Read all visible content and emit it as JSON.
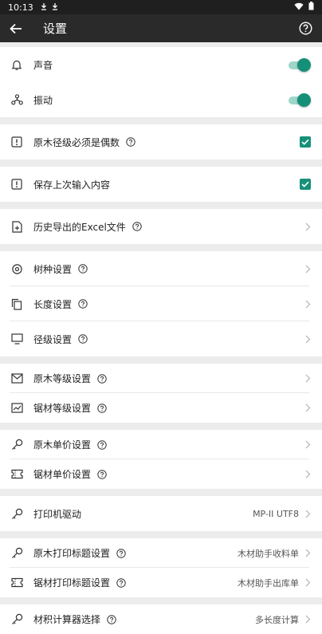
{
  "status_bar": {
    "time": "10:13",
    "icons": [
      "download-icon",
      "download-icon",
      "wifi-icon",
      "battery-icon"
    ]
  },
  "app_bar": {
    "title": "设置",
    "back_icon": "arrow-left-icon",
    "help_icon": "help-circle-icon"
  },
  "colors": {
    "accent": "#169079",
    "toggle_track": "#9fd6c9",
    "appbar": "#2a2a2a",
    "background": "#ececec"
  },
  "settings": {
    "sound": {
      "label": "声音",
      "on": true
    },
    "vibration": {
      "label": "振动",
      "on": true
    },
    "log_diameter_even": {
      "label": "原木径级必须是偶数",
      "checked": true
    },
    "save_last_input": {
      "label": "保存上次输入内容",
      "checked": true
    },
    "excel_history": {
      "label": "历史导出的Excel文件"
    },
    "species": {
      "label": "树种设置"
    },
    "length": {
      "label": "长度设置"
    },
    "diameter": {
      "label": "径级设置"
    },
    "log_grade": {
      "label": "原木等级设置"
    },
    "lumber_grade": {
      "label": "锯材等级设置"
    },
    "log_price": {
      "label": "原木单价设置"
    },
    "lumber_price": {
      "label": "锯材单价设置"
    },
    "printer_driver": {
      "label": "打印机驱动",
      "value": "MP-II UTF8"
    },
    "log_print_title": {
      "label": "原木打印标题设置",
      "value": "木材助手收料单"
    },
    "lumber_print_title": {
      "label": "锯材打印标题设置",
      "value": "木材助手出库单"
    },
    "calculator": {
      "label": "材积计算器选择",
      "value": "多长度计算"
    }
  }
}
